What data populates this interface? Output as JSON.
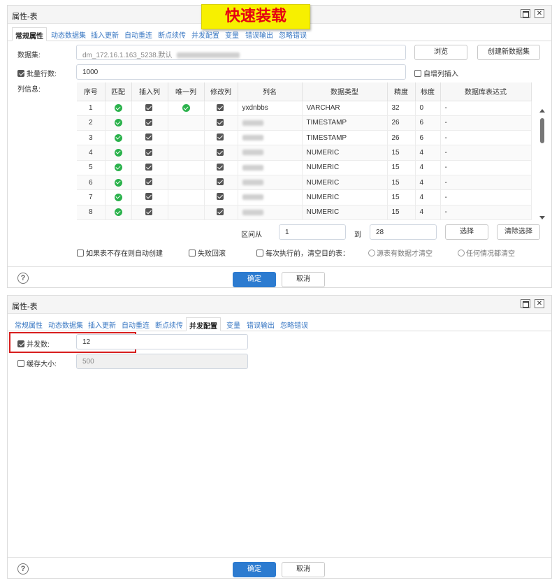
{
  "banner": "快速装载",
  "dialog1": {
    "title": "属性-表",
    "tabs": [
      "常规属性",
      "动态数据集",
      "插入更新",
      "自动重连",
      "断点续传",
      "并发配置",
      "变量",
      "错误输出",
      "忽略错误"
    ],
    "dataset_label": "数据集:",
    "dataset_value": "dm_172.16.1.163_5238.默认",
    "browse_button": "浏览",
    "create_dataset_button": "创建新数据集",
    "batch_label": "批量行数:",
    "batch_value": "1000",
    "autoinc_label": "自增列插入",
    "columns_label": "列信息:",
    "columns": [
      "序号",
      "匹配",
      "插入列",
      "唯一列",
      "修改列",
      "列名",
      "数据类型",
      "精度",
      "标度",
      "数据库表达式"
    ],
    "rows": [
      {
        "no": "1",
        "match": true,
        "insert": true,
        "unique": true,
        "modify": true,
        "name": "yxdnbbs",
        "type": "VARCHAR",
        "precision": "32",
        "scale": "0",
        "expr": "-"
      },
      {
        "no": "2",
        "match": true,
        "insert": true,
        "unique": false,
        "modify": true,
        "name": "",
        "type": "TIMESTAMP",
        "precision": "26",
        "scale": "6",
        "expr": "-"
      },
      {
        "no": "3",
        "match": true,
        "insert": true,
        "unique": false,
        "modify": true,
        "name": "",
        "type": "TIMESTAMP",
        "precision": "26",
        "scale": "6",
        "expr": "-"
      },
      {
        "no": "4",
        "match": true,
        "insert": true,
        "unique": false,
        "modify": true,
        "name": "",
        "type": "NUMERIC",
        "precision": "15",
        "scale": "4",
        "expr": "-"
      },
      {
        "no": "5",
        "match": true,
        "insert": true,
        "unique": false,
        "modify": true,
        "name": "",
        "type": "NUMERIC",
        "precision": "15",
        "scale": "4",
        "expr": "-"
      },
      {
        "no": "6",
        "match": true,
        "insert": true,
        "unique": false,
        "modify": true,
        "name": "",
        "type": "NUMERIC",
        "precision": "15",
        "scale": "4",
        "expr": "-"
      },
      {
        "no": "7",
        "match": true,
        "insert": true,
        "unique": false,
        "modify": true,
        "name": "",
        "type": "NUMERIC",
        "precision": "15",
        "scale": "4",
        "expr": "-"
      },
      {
        "no": "8",
        "match": true,
        "insert": true,
        "unique": false,
        "modify": true,
        "name": "",
        "type": "NUMERIC",
        "precision": "15",
        "scale": "4",
        "expr": "-"
      }
    ],
    "range_from_label": "区间从",
    "range_from_value": "1",
    "range_to_label": "到",
    "range_to_value": "28",
    "select_button": "选择",
    "clear_select_button": "清除选择",
    "opt_autocreate": "如果表不存在则自动创建",
    "opt_rollback": "失败回滚",
    "opt_clear": "每次执行前，清空目的表：",
    "opt_clear_if_data": "源表有数据才清空",
    "opt_clear_always": "任何情况都清空",
    "ok_button": "确定",
    "cancel_button": "取消"
  },
  "dialog2": {
    "title": "属性-表",
    "tabs": [
      "常规属性",
      "动态数据集",
      "插入更新",
      "自动重连",
      "断点续传",
      "并发配置",
      "变量",
      "错误输出",
      "忽略错误"
    ],
    "concurrency_label": "并发数:",
    "concurrency_value": "12",
    "cache_label": "缓存大小:",
    "cache_value": "500",
    "ok_button": "确定",
    "cancel_button": "取消"
  },
  "colors": {
    "accent": "#2c7bd0",
    "banner_bg": "#f7f000",
    "banner_text": "#e60012",
    "highlight_box": "#d81e1e",
    "check_green": "#2bb24c"
  }
}
